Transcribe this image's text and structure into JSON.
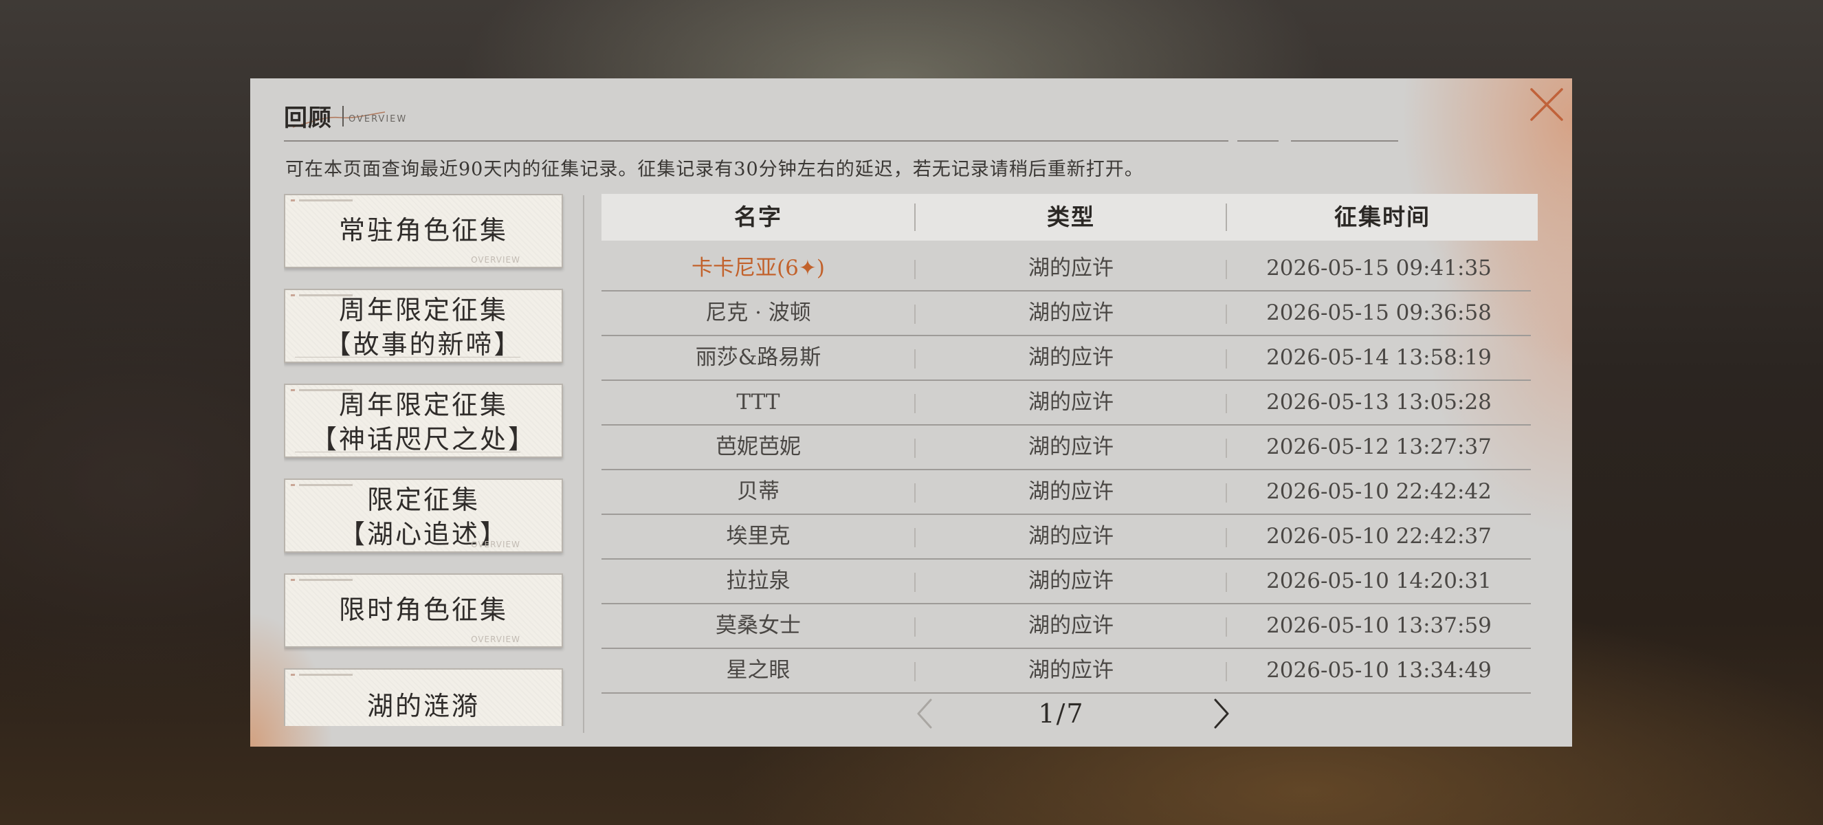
{
  "header": {
    "title": "回顾",
    "subtitle": "OVERVIEW",
    "notice": "可在本页面查询最近90天内的征集记录。征集记录有30分钟左右的延迟，若无记录请稍后重新打开。"
  },
  "banners": [
    {
      "line1": "常驻角色征集",
      "line2": "",
      "footer": "OVERVIEW"
    },
    {
      "line1": "周年限定征集",
      "line2": "【故事的新啼】",
      "footer": ""
    },
    {
      "line1": "周年限定征集",
      "line2": "【神话咫尺之处】",
      "footer": ""
    },
    {
      "line1": "限定征集",
      "line2": "【湖心追述】",
      "footer": "OVERVIEW"
    },
    {
      "line1": "限时角色征集",
      "line2": "",
      "footer": "OVERVIEW"
    },
    {
      "line1": "湖的涟漪",
      "line2": "",
      "footer": ""
    }
  ],
  "table": {
    "columns": [
      "名字",
      "类型",
      "征集时间"
    ],
    "rows": [
      {
        "name": "卡卡尼亚(6✦)",
        "type": "湖的应许",
        "time": "2026-05-15 09:41:35",
        "highlight": true
      },
      {
        "name": "尼克 · 波顿",
        "type": "湖的应许",
        "time": "2026-05-15 09:36:58"
      },
      {
        "name": "丽莎&路易斯",
        "type": "湖的应许",
        "time": "2026-05-14 13:58:19"
      },
      {
        "name": "TTT",
        "type": "湖的应许",
        "time": "2026-05-13 13:05:28"
      },
      {
        "name": "芭妮芭妮",
        "type": "湖的应许",
        "time": "2026-05-12 13:27:37"
      },
      {
        "name": "贝蒂",
        "type": "湖的应许",
        "time": "2026-05-10 22:42:42"
      },
      {
        "name": "埃里克",
        "type": "湖的应许",
        "time": "2026-05-10 22:42:37"
      },
      {
        "name": "拉拉泉",
        "type": "湖的应许",
        "time": "2026-05-10 14:20:31"
      },
      {
        "name": "莫桑女士",
        "type": "湖的应许",
        "time": "2026-05-10 13:37:59"
      },
      {
        "name": "星之眼",
        "type": "湖的应许",
        "time": "2026-05-10 13:34:49"
      }
    ]
  },
  "pager": {
    "current": 1,
    "total": 7,
    "text": "1/7"
  },
  "colors": {
    "accent": "#c2622c",
    "panel": "#d1d0ce",
    "close": "#c0623a"
  },
  "icons": {
    "close": "close-icon",
    "prev": "chevron-left-icon",
    "next": "chevron-right-icon"
  }
}
